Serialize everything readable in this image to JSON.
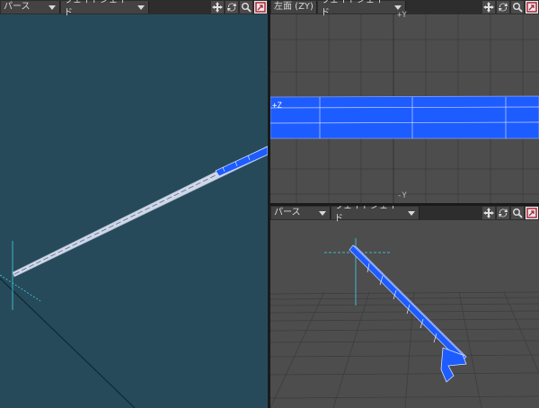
{
  "viewport_persp_left": {
    "view_mode": "パース",
    "shading": "ウェイトシェイド"
  },
  "viewport_left_zy": {
    "title": "左面 (ZY)",
    "shading": "ウェイトシェイド",
    "axis_top": "+Y",
    "axis_bottom": "-Y",
    "axis_left": "+Z"
  },
  "viewport_persp_right": {
    "view_mode": "パース",
    "shading": "ウェイトシェイド"
  },
  "icons": [
    "move-view-icon",
    "rotate-view-icon",
    "zoom-view-icon",
    "maximize-view-icon"
  ],
  "colors": {
    "persp_bg": "#264a5a",
    "ortho_bg": "#4d4d4d",
    "mesh_blue": "#1d5cff",
    "toolbar_bg": "#2d2d2d"
  }
}
